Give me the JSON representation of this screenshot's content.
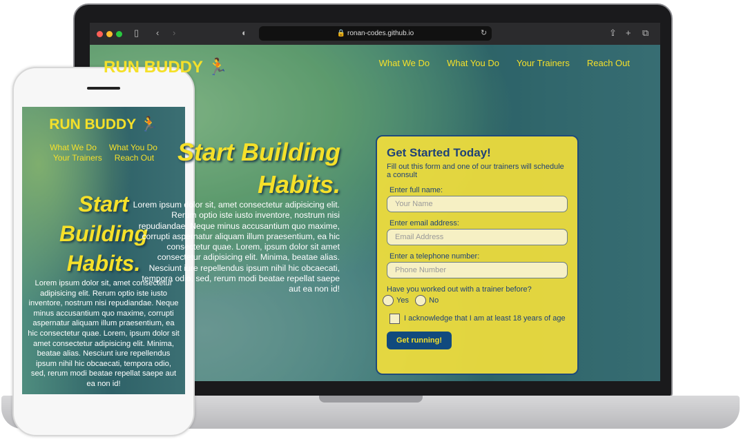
{
  "browser": {
    "url": "ronan-codes.github.io"
  },
  "site": {
    "logo": "RUN BUDDY 🏃",
    "nav": [
      "What We Do",
      "What You Do",
      "Your Trainers",
      "Reach Out"
    ],
    "hero_title_desktop": "Start Building Habits.",
    "hero_title_lines": [
      "Start",
      "Building",
      "Habits."
    ],
    "hero_text": "Lorem ipsum dolor sit, amet consectetur adipisicing elit. Rerum optio iste iusto inventore, nostrum nisi repudiandae. Neque minus accusantium quo maxime, corrupti aspernatur aliquam illum praesentium, ea hic consectetur quae. Lorem, ipsum dolor sit amet consectetur adipisicing elit. Minima, beatae alias. Nesciunt iure repellendus ipsum nihil hic obcaecati, tempora odio, sed, rerum modi beatae repellat saepe aut ea non id!"
  },
  "form": {
    "title": "Get Started Today!",
    "subtitle": "Fill out this form and one of our trainers will schedule a consult",
    "name_label": "Enter full name:",
    "name_placeholder": "Your Name",
    "email_label": "Enter email address:",
    "email_placeholder": "Email Address",
    "phone_label": "Enter a telephone number:",
    "phone_placeholder": "Phone Number",
    "trainer_question": "Have you worked out with a trainer before?",
    "yes": "Yes",
    "no": "No",
    "age_ack": "I acknowledge that I am at least 18 years of age",
    "submit": "Get running!"
  },
  "colors": {
    "accent": "#f5e02a",
    "navy": "#1e4178"
  }
}
